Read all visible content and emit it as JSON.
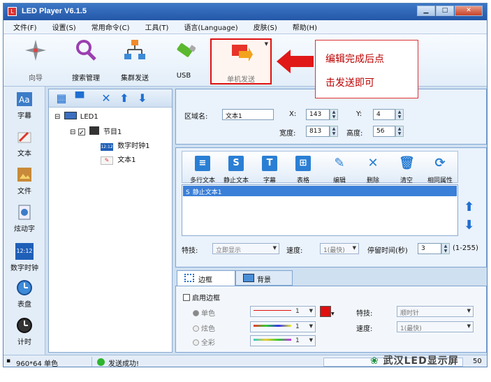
{
  "window": {
    "title": "LED Player V6.1.5",
    "btn_min": "▁",
    "btn_max": "□",
    "btn_close": "✕"
  },
  "menu": [
    "文件(F)",
    "设置(S)",
    "常用命令(C)",
    "工具(T)",
    "语言(Language)",
    "皮肤(S)",
    "帮助(H)"
  ],
  "toolbar": {
    "guide": "向导",
    "search": "搜索管理",
    "cluster": "集群发送",
    "usb": "USB",
    "single_send": "单机发送"
  },
  "annotation": {
    "line1": "编辑完成后点",
    "line2": "击发送即可"
  },
  "leftbar": {
    "subtitle": "字幕",
    "text": "文本",
    "file": "文件",
    "flash": "炫动字",
    "clock": "数字时钟",
    "clock_icon": "12:12",
    "dial": "表盘",
    "timer": "计时"
  },
  "tree": {
    "root": "LED1",
    "program": "节目1",
    "clock": "数字时钟1",
    "text": "文本1",
    "clock_icon": "12:12"
  },
  "region": {
    "name_label": "区域名:",
    "name_value": "文本1",
    "x_label": "X:",
    "x_value": "143",
    "y_label": "Y:",
    "y_value": "4",
    "w_label": "宽度:",
    "w_value": "813",
    "h_label": "高度:",
    "h_value": "56"
  },
  "texttoolbar": {
    "multi": "多行文本",
    "static": "静止文本",
    "subtitle": "字幕",
    "table": "表格",
    "edit": "编辑",
    "delete": "删除",
    "clear": "清空",
    "same": "相同属性"
  },
  "list": {
    "row1": "静止文本1",
    "row_icon": "S"
  },
  "effects": {
    "label": "特技:",
    "value": "立即显示",
    "speed_label": "速度:",
    "speed_value": "1(最快)",
    "stay_label": "停留时间(秒)",
    "stay_value": "3",
    "range": "(1-255)"
  },
  "tabs": {
    "border": "边框",
    "background": "背景"
  },
  "border": {
    "enable": "启用边框",
    "single": "单色",
    "flash": "炫色",
    "full": "全彩",
    "line_num": "1",
    "effect_label": "特技:",
    "effect_value": "顺时针",
    "speed_label": "速度:",
    "speed_value": "1(最快)",
    "color": "#e01010"
  },
  "status": {
    "resolution": "960*64 单色",
    "message": "发送成功!",
    "right": "50"
  },
  "watermark": "武汉LED显示屏"
}
